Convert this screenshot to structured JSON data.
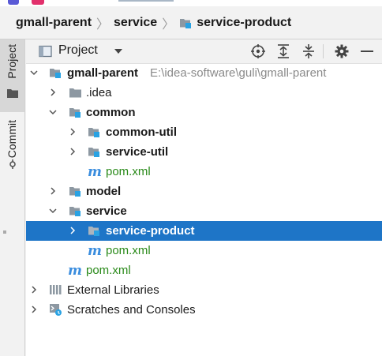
{
  "breadcrumb": {
    "items": [
      "gmall-parent",
      "service",
      "service-product"
    ]
  },
  "sidebar": {
    "tabs": [
      "Project",
      "Commit"
    ]
  },
  "toolbar": {
    "title": "Project"
  },
  "tree": {
    "root": {
      "name": "gmall-parent",
      "path": "E:\\idea-software\\guli\\gmall-parent"
    },
    "idea": ".idea",
    "common": "common",
    "common_util": "common-util",
    "service_util": "service-util",
    "common_pom": "pom.xml",
    "model": "model",
    "service": "service",
    "service_product": "service-product",
    "service_pom": "pom.xml",
    "root_pom": "pom.xml",
    "external_libraries": "External Libraries",
    "scratches": "Scratches and Consoles"
  },
  "colors": {
    "selection": "#1e75c7",
    "module_badge": "#29a2e3",
    "maven_file": "#2a8a1a",
    "folder": "#8d98a2"
  }
}
